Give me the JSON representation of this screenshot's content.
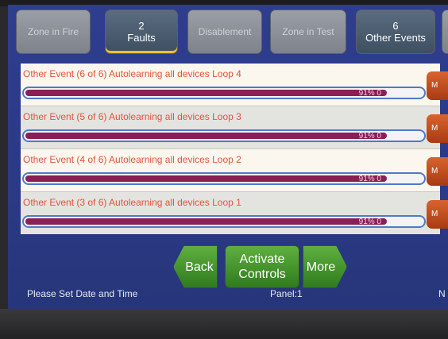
{
  "tabs": [
    {
      "line1": "Zone in Fire",
      "line2": ""
    },
    {
      "line1": "2",
      "line2": "Faults"
    },
    {
      "line1": "Disablement",
      "line2": ""
    },
    {
      "line1": "Zone in Test",
      "line2": ""
    },
    {
      "line1": "6",
      "line2": "Other Events"
    }
  ],
  "events": [
    {
      "text": "Other Event (6 of 6) Autolearning all devices Loop 4",
      "progress_label": "91% 0",
      "progress": 0.91,
      "button": "M"
    },
    {
      "text": "Other Event (5 of 6) Autolearning all devices Loop 3",
      "progress_label": "91% 0",
      "progress": 0.91,
      "button": "M"
    },
    {
      "text": "Other Event (4 of 6) Autolearning all devices Loop 2",
      "progress_label": "91% 0",
      "progress": 0.91,
      "button": "M"
    },
    {
      "text": "Other Event (3 of 6) Autolearning all devices Loop 1",
      "progress_label": "91% 0",
      "progress": 0.91,
      "button": "M"
    }
  ],
  "controls": {
    "back": "Back",
    "activate": "Activate Controls",
    "more": "More"
  },
  "status": {
    "message": "Please Set Date and Time",
    "panel": "Panel:1",
    "right": "N"
  }
}
